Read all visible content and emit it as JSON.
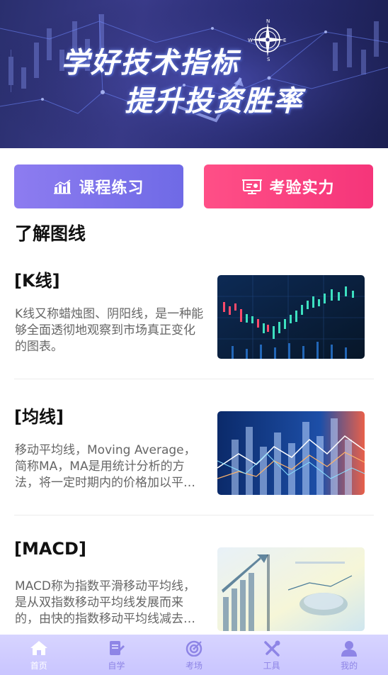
{
  "banner": {
    "line1": "学好技术指标",
    "line2": "提升投资胜率"
  },
  "actions": {
    "practice_label": "课程练习",
    "exam_label": "考验实力"
  },
  "section_title": "了解图线",
  "articles": [
    {
      "title": "[K线]",
      "desc": "K线又称蜡烛图、阴阳线，是一种能够全面透彻地观察到市场真正变化的图表。"
    },
    {
      "title": "[均线]",
      "desc": "移动平均线，Moving Average，简称MA，MA是用统计分析的方法，将一定时期内的价格加以平均，并把不同时间的平均值连接起来。"
    },
    {
      "title": "[MACD]",
      "desc": "MACD称为指数平滑移动平均线，是从双指数移动平均线发展而来的，由快的指数移动平均线减去慢的指数移动平均线。"
    }
  ],
  "tabs": [
    {
      "label": "首页",
      "icon": "home-icon",
      "active": true
    },
    {
      "label": "自学",
      "icon": "study-icon",
      "active": false
    },
    {
      "label": "考场",
      "icon": "target-icon",
      "active": false
    },
    {
      "label": "工具",
      "icon": "tools-icon",
      "active": false
    },
    {
      "label": "我的",
      "icon": "user-icon",
      "active": false
    }
  ],
  "colors": {
    "practice_button": "#7d73ec",
    "exam_button": "#f8407f",
    "tabbar": "#d0ccff",
    "tab_active_text": "#ffffff",
    "tab_inactive_text": "#8e85e6"
  }
}
